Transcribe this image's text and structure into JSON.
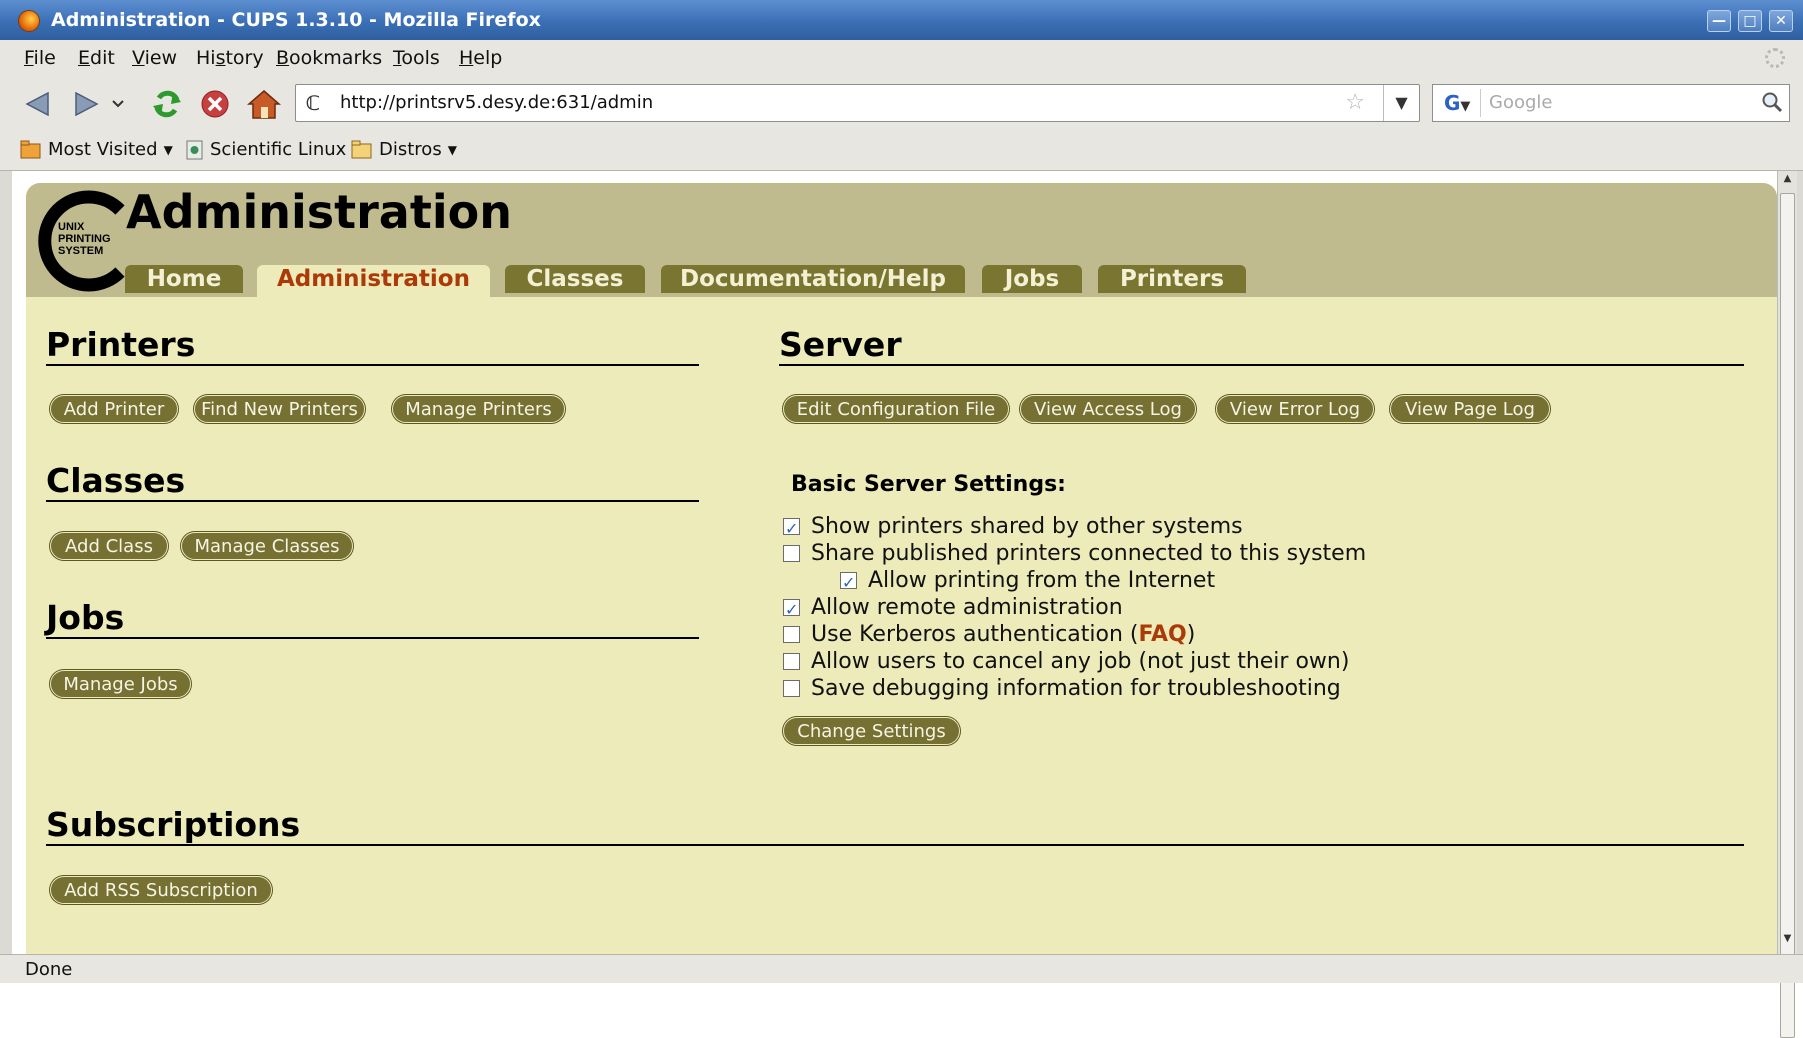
{
  "window": {
    "title": "Administration - CUPS 1.3.10 - Mozilla Firefox"
  },
  "menu": [
    "File",
    "Edit",
    "View",
    "History",
    "Bookmarks",
    "Tools",
    "Help"
  ],
  "toolbar": {
    "url": "http://printsrv5.desy.de:631/admin",
    "search_placeholder": "Google"
  },
  "bookmarks": {
    "most_visited": "Most Visited",
    "scientific_linux": "Scientific Linux",
    "distros": "Distros"
  },
  "logo_text": [
    "UNIX",
    "PRINTING",
    "SYSTEM"
  ],
  "page": {
    "title": "Administration",
    "tabs": [
      "Home",
      "Administration",
      "Classes",
      "Documentation/Help",
      "Jobs",
      "Printers"
    ],
    "active_tab": "Administration"
  },
  "printers": {
    "heading": "Printers",
    "buttons": [
      "Add Printer",
      "Find New Printers",
      "Manage Printers"
    ]
  },
  "classes": {
    "heading": "Classes",
    "buttons": [
      "Add Class",
      "Manage Classes"
    ]
  },
  "jobs": {
    "heading": "Jobs",
    "buttons": [
      "Manage Jobs"
    ]
  },
  "server": {
    "heading": "Server",
    "buttons": [
      "Edit Configuration File",
      "View Access Log",
      "View Error Log",
      "View Page Log"
    ],
    "settings_heading": "Basic Server Settings:",
    "settings": [
      {
        "label": "Show printers shared by other systems",
        "checked": true
      },
      {
        "label": "Share published printers connected to this system",
        "checked": false
      },
      {
        "label": "Allow printing from the Internet",
        "checked": true
      },
      {
        "label": "Allow remote administration",
        "checked": true
      },
      {
        "label": "Use Kerberos authentication (",
        "link": "FAQ",
        "suffix": ")",
        "checked": false
      },
      {
        "label": "Allow users to cancel any job (not just their own)",
        "checked": false
      },
      {
        "label": "Save debugging information for troubleshooting",
        "checked": false
      }
    ],
    "change_button": "Change Settings"
  },
  "subscriptions": {
    "heading": "Subscriptions",
    "buttons": [
      "Add RSS Subscription"
    ]
  },
  "status": "Done",
  "colors": {
    "header_bg": "#c0bb8e",
    "page_bg": "#ecebb9",
    "tab_bg": "#7a7530",
    "active_tab_text": "#ac3a08",
    "button_bg": "#767133"
  }
}
